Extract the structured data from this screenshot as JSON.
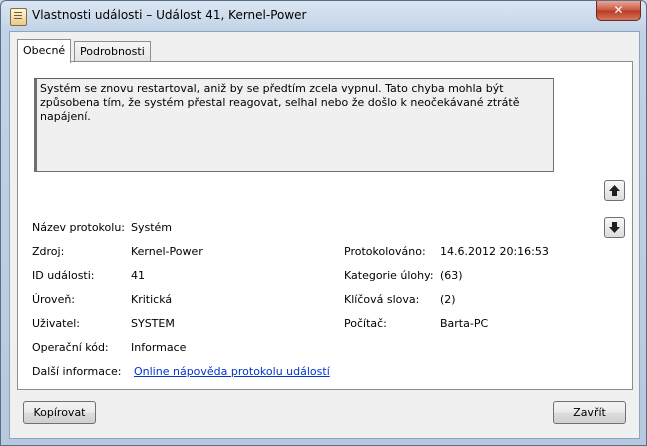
{
  "window": {
    "title": "Vlastnosti události – Událost 41, Kernel-Power",
    "close_label": "✕"
  },
  "tabs": [
    {
      "label": "Obecné",
      "active": true
    },
    {
      "label": "Podrobnosti",
      "active": false
    }
  ],
  "description": "Systém se znovu restartoval, aniž by se předtím zcela vypnul. Tato chyba mohla být způsobena tím, že systém přestal reagovat, selhal nebo že došlo k neočekávané ztrátě napájení.",
  "fields": {
    "log_name": {
      "label": "Název protokolu:",
      "value": "Systém"
    },
    "source": {
      "label": "Zdroj:",
      "value": "Kernel-Power"
    },
    "event_id": {
      "label": "ID události:",
      "value": "41"
    },
    "level": {
      "label": "Úroveň:",
      "value": "Kritická"
    },
    "user": {
      "label": "Uživatel:",
      "value": "SYSTEM"
    },
    "opcode": {
      "label": "Operační kód:",
      "value": "Informace"
    },
    "more_info": {
      "label": "Další informace:",
      "value": "Online nápověda protokolu událostí"
    },
    "logged": {
      "label": "Protokolováno:",
      "value": "14.6.2012 20:16:53"
    },
    "task_category": {
      "label": "Kategorie úlohy:",
      "value": "(63)"
    },
    "keywords": {
      "label": "Klíčová slova:",
      "value": "(2)"
    },
    "computer": {
      "label": "Počítač:",
      "value": "Barta-PC"
    }
  },
  "buttons": {
    "copy": "Kopírovat",
    "close": "Zavřít"
  },
  "icons": {
    "up": "arrow-up-icon",
    "down": "arrow-down-icon"
  }
}
